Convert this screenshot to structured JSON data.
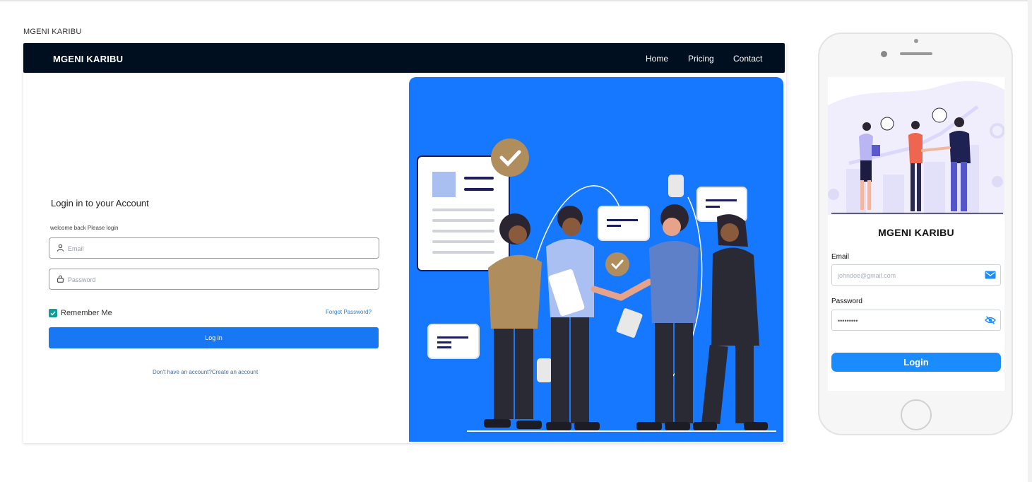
{
  "frame_label": "MGENI KARIBU",
  "navbar": {
    "brand": "MGENI KARIBU",
    "links": [
      "Home",
      "Pricing",
      "Contact"
    ]
  },
  "login": {
    "title": "Login in to your Account",
    "subtitle": "welcome back  Please login",
    "email_placeholder": "Email",
    "password_placeholder": "Password",
    "remember_label": "Remember Me",
    "remember_checked": true,
    "forgot_label": "Forgot Password?",
    "button_label": "Log in",
    "signup_prompt": "Don't have an account?",
    "signup_link": "Create an account"
  },
  "mobile": {
    "brand": "MGENI KARIBU",
    "email_label": "Email",
    "email_placeholder": "johndoe@gmail.com",
    "password_label": "Password",
    "password_value": "•••••••••",
    "button_label": "Login"
  },
  "colors": {
    "navbar_bg": "#000f1f",
    "accent_blue": "#1677ff",
    "button_blue": "#1877f2",
    "checkbox_teal": "#0b9e9c",
    "mobile_button": "#1a8cff"
  },
  "icons": [
    "user-icon",
    "lock-icon",
    "check-icon",
    "mail-icon",
    "eye-slash-icon"
  ]
}
